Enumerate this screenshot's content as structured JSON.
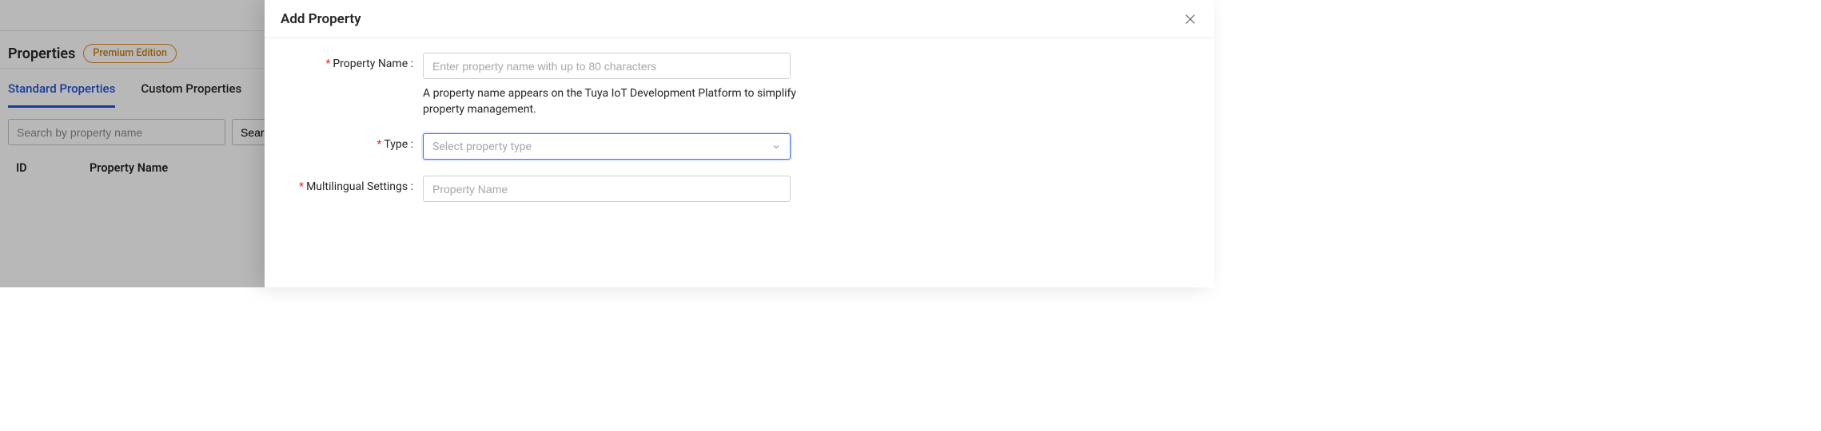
{
  "page": {
    "title": "Properties",
    "badge": "Premium Edition",
    "tabs": [
      {
        "label": "Standard Properties",
        "active": true
      },
      {
        "label": "Custom Properties",
        "active": false
      }
    ],
    "search_placeholder": "Search by property name",
    "search_button": "Search",
    "table_headers": {
      "id": "ID",
      "name": "Property Name"
    }
  },
  "drawer": {
    "title": "Add Property",
    "fields": {
      "property_name": {
        "label": "Property Name",
        "placeholder": "Enter property name with up to 80 characters",
        "help": "A property name appears on the Tuya IoT Development Platform to simplify property management."
      },
      "type": {
        "label": "Type",
        "placeholder": "Select property type"
      },
      "multilingual": {
        "label": "Multilingual Settings",
        "placeholder": "Property Name"
      }
    }
  }
}
